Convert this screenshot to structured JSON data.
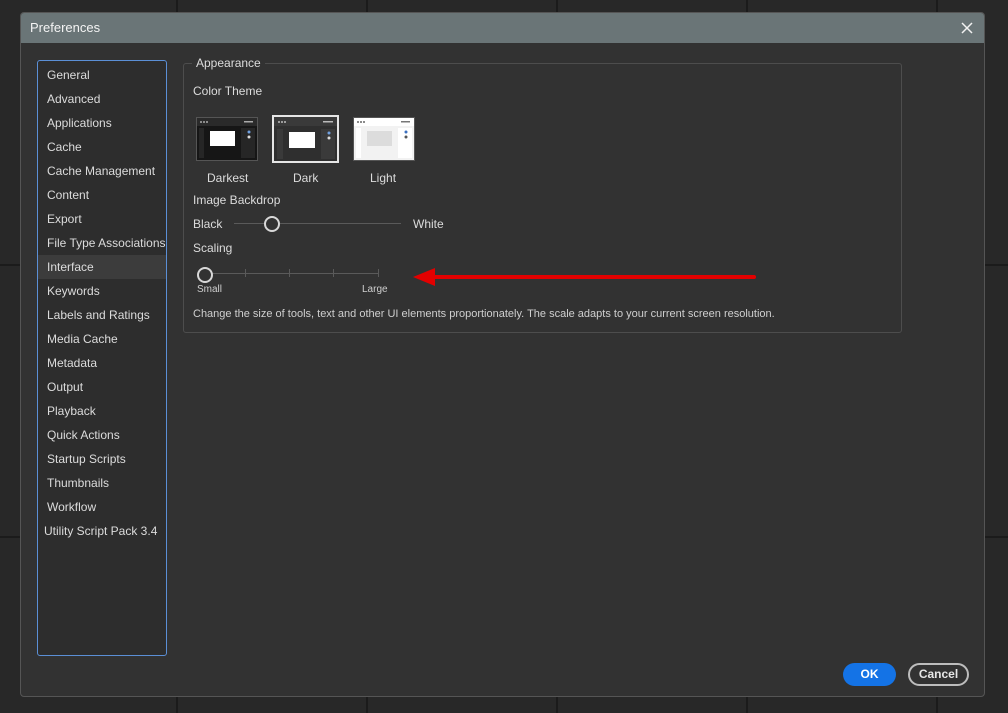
{
  "dialog": {
    "title": "Preferences",
    "close_icon": "close-icon"
  },
  "sidebar": {
    "items": [
      {
        "label": "General"
      },
      {
        "label": "Advanced"
      },
      {
        "label": "Applications"
      },
      {
        "label": "Cache"
      },
      {
        "label": "Cache Management"
      },
      {
        "label": "Content"
      },
      {
        "label": "Export"
      },
      {
        "label": "File Type Associations"
      },
      {
        "label": "Interface",
        "selected": true
      },
      {
        "label": "Keywords"
      },
      {
        "label": "Labels and Ratings"
      },
      {
        "label": "Media Cache"
      },
      {
        "label": "Metadata"
      },
      {
        "label": "Output"
      },
      {
        "label": "Playback"
      },
      {
        "label": "Quick Actions"
      },
      {
        "label": "Startup Scripts"
      },
      {
        "label": "Thumbnails"
      },
      {
        "label": "Workflow"
      },
      {
        "label": "Utility Script Pack 3.4"
      }
    ]
  },
  "appearance": {
    "group_title": "Appearance",
    "color_theme_label": "Color Theme",
    "themes": [
      {
        "label": "Darkest",
        "selected": false
      },
      {
        "label": "Dark",
        "selected": true
      },
      {
        "label": "Light",
        "selected": false
      }
    ],
    "backdrop": {
      "label": "Image Backdrop",
      "min_label": "Black",
      "max_label": "White",
      "value_fraction": 0.22
    },
    "scaling": {
      "label": "Scaling",
      "min_label": "Small",
      "max_label": "Large",
      "value_fraction": 0.0,
      "ticks": 5
    },
    "description": "Change the size of tools, text and other UI elements proportionately. The scale adapts to your current screen resolution."
  },
  "buttons": {
    "ok": "OK",
    "cancel": "Cancel"
  },
  "colors": {
    "titlebar": "#6a7577",
    "accent": "#1473e6",
    "sidebar_border": "#5b8fd6",
    "annotation_arrow": "#e30000"
  }
}
